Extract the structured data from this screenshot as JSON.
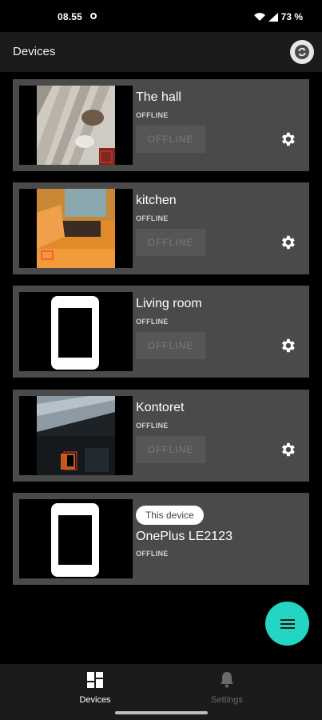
{
  "status_bar": {
    "time": "08.55",
    "battery": "73 %"
  },
  "app_bar": {
    "title": "Devices"
  },
  "devices": [
    {
      "name": "The hall",
      "status": "OFFLINE",
      "button_label": "OFFLINE"
    },
    {
      "name": "kitchen",
      "status": "OFFLINE",
      "button_label": "OFFLINE"
    },
    {
      "name": "Living room",
      "status": "OFFLINE",
      "button_label": "OFFLINE"
    },
    {
      "name": "Kontoret",
      "status": "OFFLINE",
      "button_label": "OFFLINE"
    },
    {
      "name": "OnePlus LE2123",
      "status": "OFFLINE",
      "badge": "This device"
    }
  ],
  "bottom_nav": {
    "devices_label": "Devices",
    "settings_label": "Settings"
  },
  "colors": {
    "accent": "#23d6c4",
    "card": "#4a4a4a",
    "bar": "#1b1b1b"
  },
  "icons": [
    "refresh-icon",
    "gear-icon",
    "menu-icon",
    "grid-icon",
    "bell-icon",
    "wifi-icon",
    "signal-icon",
    "battery-icon"
  ]
}
